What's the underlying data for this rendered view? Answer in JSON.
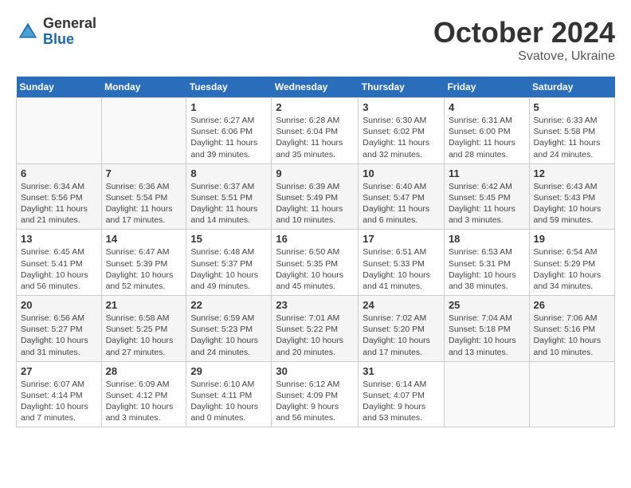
{
  "header": {
    "logo_general": "General",
    "logo_blue": "Blue",
    "month_title": "October 2024",
    "subtitle": "Svatove, Ukraine"
  },
  "days_of_week": [
    "Sunday",
    "Monday",
    "Tuesday",
    "Wednesday",
    "Thursday",
    "Friday",
    "Saturday"
  ],
  "weeks": [
    [
      {
        "day": "",
        "info": ""
      },
      {
        "day": "",
        "info": ""
      },
      {
        "day": "1",
        "info": "Sunrise: 6:27 AM\nSunset: 6:06 PM\nDaylight: 11 hours and 39 minutes."
      },
      {
        "day": "2",
        "info": "Sunrise: 6:28 AM\nSunset: 6:04 PM\nDaylight: 11 hours and 35 minutes."
      },
      {
        "day": "3",
        "info": "Sunrise: 6:30 AM\nSunset: 6:02 PM\nDaylight: 11 hours and 32 minutes."
      },
      {
        "day": "4",
        "info": "Sunrise: 6:31 AM\nSunset: 6:00 PM\nDaylight: 11 hours and 28 minutes."
      },
      {
        "day": "5",
        "info": "Sunrise: 6:33 AM\nSunset: 5:58 PM\nDaylight: 11 hours and 24 minutes."
      }
    ],
    [
      {
        "day": "6",
        "info": "Sunrise: 6:34 AM\nSunset: 5:56 PM\nDaylight: 11 hours and 21 minutes."
      },
      {
        "day": "7",
        "info": "Sunrise: 6:36 AM\nSunset: 5:54 PM\nDaylight: 11 hours and 17 minutes."
      },
      {
        "day": "8",
        "info": "Sunrise: 6:37 AM\nSunset: 5:51 PM\nDaylight: 11 hours and 14 minutes."
      },
      {
        "day": "9",
        "info": "Sunrise: 6:39 AM\nSunset: 5:49 PM\nDaylight: 11 hours and 10 minutes."
      },
      {
        "day": "10",
        "info": "Sunrise: 6:40 AM\nSunset: 5:47 PM\nDaylight: 11 hours and 6 minutes."
      },
      {
        "day": "11",
        "info": "Sunrise: 6:42 AM\nSunset: 5:45 PM\nDaylight: 11 hours and 3 minutes."
      },
      {
        "day": "12",
        "info": "Sunrise: 6:43 AM\nSunset: 5:43 PM\nDaylight: 10 hours and 59 minutes."
      }
    ],
    [
      {
        "day": "13",
        "info": "Sunrise: 6:45 AM\nSunset: 5:41 PM\nDaylight: 10 hours and 56 minutes."
      },
      {
        "day": "14",
        "info": "Sunrise: 6:47 AM\nSunset: 5:39 PM\nDaylight: 10 hours and 52 minutes."
      },
      {
        "day": "15",
        "info": "Sunrise: 6:48 AM\nSunset: 5:37 PM\nDaylight: 10 hours and 49 minutes."
      },
      {
        "day": "16",
        "info": "Sunrise: 6:50 AM\nSunset: 5:35 PM\nDaylight: 10 hours and 45 minutes."
      },
      {
        "day": "17",
        "info": "Sunrise: 6:51 AM\nSunset: 5:33 PM\nDaylight: 10 hours and 41 minutes."
      },
      {
        "day": "18",
        "info": "Sunrise: 6:53 AM\nSunset: 5:31 PM\nDaylight: 10 hours and 38 minutes."
      },
      {
        "day": "19",
        "info": "Sunrise: 6:54 AM\nSunset: 5:29 PM\nDaylight: 10 hours and 34 minutes."
      }
    ],
    [
      {
        "day": "20",
        "info": "Sunrise: 6:56 AM\nSunset: 5:27 PM\nDaylight: 10 hours and 31 minutes."
      },
      {
        "day": "21",
        "info": "Sunrise: 6:58 AM\nSunset: 5:25 PM\nDaylight: 10 hours and 27 minutes."
      },
      {
        "day": "22",
        "info": "Sunrise: 6:59 AM\nSunset: 5:23 PM\nDaylight: 10 hours and 24 minutes."
      },
      {
        "day": "23",
        "info": "Sunrise: 7:01 AM\nSunset: 5:22 PM\nDaylight: 10 hours and 20 minutes."
      },
      {
        "day": "24",
        "info": "Sunrise: 7:02 AM\nSunset: 5:20 PM\nDaylight: 10 hours and 17 minutes."
      },
      {
        "day": "25",
        "info": "Sunrise: 7:04 AM\nSunset: 5:18 PM\nDaylight: 10 hours and 13 minutes."
      },
      {
        "day": "26",
        "info": "Sunrise: 7:06 AM\nSunset: 5:16 PM\nDaylight: 10 hours and 10 minutes."
      }
    ],
    [
      {
        "day": "27",
        "info": "Sunrise: 6:07 AM\nSunset: 4:14 PM\nDaylight: 10 hours and 7 minutes."
      },
      {
        "day": "28",
        "info": "Sunrise: 6:09 AM\nSunset: 4:12 PM\nDaylight: 10 hours and 3 minutes."
      },
      {
        "day": "29",
        "info": "Sunrise: 6:10 AM\nSunset: 4:11 PM\nDaylight: 10 hours and 0 minutes."
      },
      {
        "day": "30",
        "info": "Sunrise: 6:12 AM\nSunset: 4:09 PM\nDaylight: 9 hours and 56 minutes."
      },
      {
        "day": "31",
        "info": "Sunrise: 6:14 AM\nSunset: 4:07 PM\nDaylight: 9 hours and 53 minutes."
      },
      {
        "day": "",
        "info": ""
      },
      {
        "day": "",
        "info": ""
      }
    ]
  ]
}
